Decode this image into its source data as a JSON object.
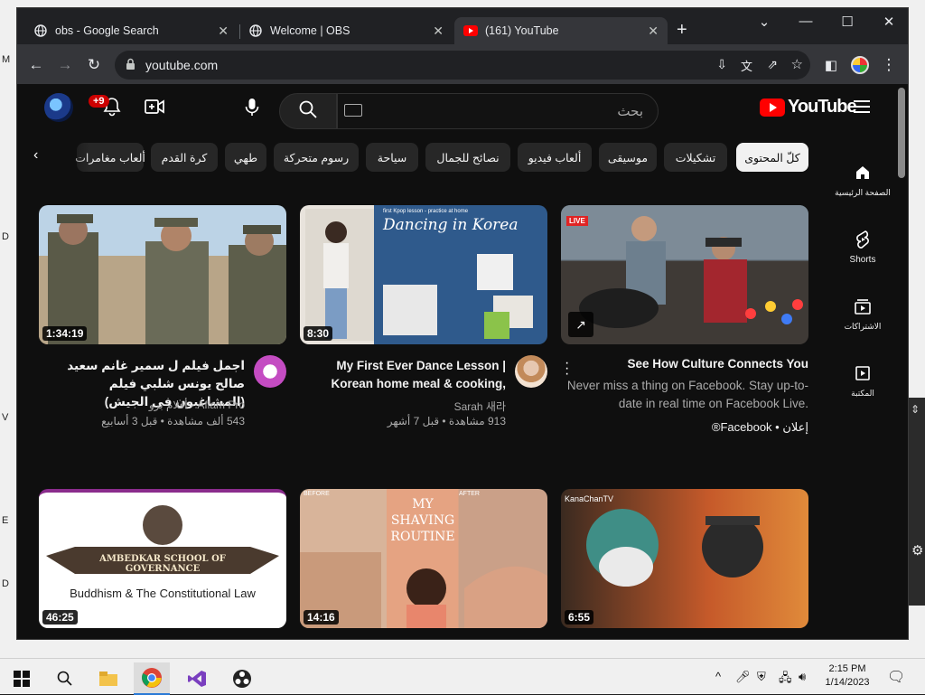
{
  "browser": {
    "tabs": [
      {
        "title": "obs - Google Search",
        "icon": "globe-icon"
      },
      {
        "title": "Welcome | OBS",
        "icon": "globe-icon"
      },
      {
        "title": "(161) YouTube",
        "icon": "youtube-icon"
      }
    ],
    "url": "youtube.com"
  },
  "youtube": {
    "notifications_badge": "+9",
    "search_placeholder": "بحث",
    "logo_text": "YouTube",
    "chips": [
      "كلّ المحتوى",
      "تشكيلات",
      "موسيقى",
      "ألعاب فيديو",
      "نصائح للجمال",
      "سياحة",
      "رسوم متحركة",
      "طهي",
      "كرة القدم",
      "ألعاب مغامرات"
    ],
    "rail": [
      {
        "label": "الصفحة الرئيسية",
        "icon": "home-icon"
      },
      {
        "label": "Shorts",
        "icon": "shorts-icon"
      },
      {
        "label": "الاشتراكات",
        "icon": "subscriptions-icon"
      },
      {
        "label": "المكتبة",
        "icon": "library-icon"
      }
    ],
    "videos": [
      {
        "duration": "1:34:19",
        "title": "اجمل فيلم ل سمير غانم سعيد صالح يونس شلبي فيلم (المشاغبون فى الجيش)",
        "channel": "Aflam Pro - أفلام برو",
        "stats": "543 ألف مشاهدة • قبل 3 أسابيع"
      },
      {
        "duration": "8:30",
        "title": "My First Ever Dance Lesson | Korean home meal & cooking,",
        "channel": "Sarah 새라",
        "stats": "913 مشاهدة • قبل 7 أشهر",
        "thumb_text": "Dancing in Korea",
        "thumb_small": "first Kpop lesson - practice at home"
      },
      {
        "ad": true,
        "live_label": "LIVE",
        "title": "See How Culture Connects You",
        "desc": "Never miss a thing on Facebook. Stay up-to-date in real time on Facebook Live.",
        "sponsor": "إعلان • Facebook®"
      },
      {
        "duration": "46:25",
        "thumb_text": "AMBEDKAR SCHOOL OF GOVERNANCE",
        "thumb_sub": "Buddhism & The Constitutional Law"
      },
      {
        "duration": "14:16",
        "thumb_text": "MY SHAVING ROUTINE",
        "thumb_before": "BEFORE",
        "thumb_after": "AFTER"
      },
      {
        "duration": "6:55",
        "thumb_channel": "KanaChanTV"
      }
    ]
  },
  "taskbar": {
    "time": "2:15 PM",
    "date": "1/14/2023"
  },
  "colors": {
    "yt_red": "#ff0000",
    "bg": "#0f0f0f",
    "chip": "#272727"
  }
}
